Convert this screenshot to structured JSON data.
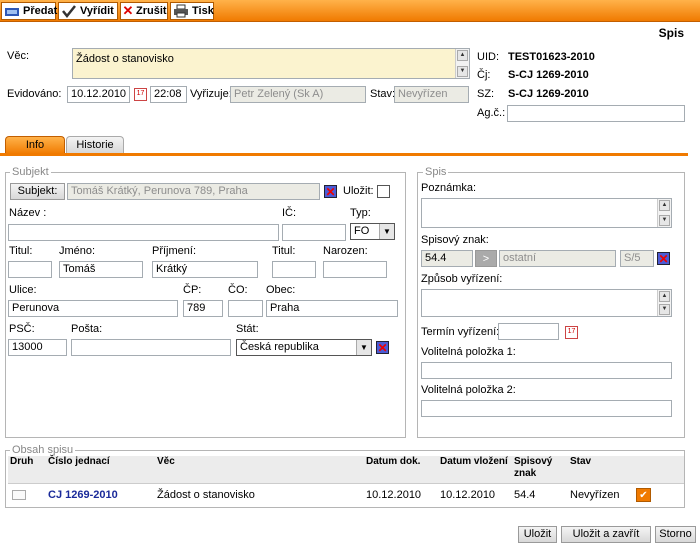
{
  "toolbar": {
    "predat": "Předat",
    "vyridit": "Vyřídit",
    "zrusit": "Zrušit",
    "tisk": "Tisk"
  },
  "page_title": "Spis",
  "header": {
    "vec_label": "Věc:",
    "vec_value": "Žádost o stanovisko",
    "uid_label": "UID:",
    "uid_value": "TEST01623-2010",
    "cj_label": "Čj:",
    "cj_value": "S-CJ 1269-2010",
    "sz_label": "SZ:",
    "sz_value": "S-CJ 1269-2010",
    "agc_label": "Ag.č.:",
    "agc_value": "",
    "evidovano_label": "Evidováno:",
    "evidovano_date": "10.12.2010",
    "evidovano_time": "22:08",
    "vyrizuje_label": "Vyřizuje:",
    "vyrizuje_value": "Petr Zelený (Sk A)",
    "stav_label": "Stav:",
    "stav_value": "Nevyřízen"
  },
  "tabs": {
    "info": "Info",
    "historie": "Historie"
  },
  "subjekt": {
    "legend": "Subjekt",
    "subjekt_button": "Subjekt:",
    "subjekt_value": "Tomáš Krátký, Perunova 789, Praha",
    "ulozit_label": "Uložit:",
    "nazev_label": "Název :",
    "nazev_value": "",
    "ic_label": "IČ:",
    "ic_value": "",
    "typ_label": "Typ:",
    "typ_value": "FO",
    "titul_label": "Titul:",
    "titul_value": "",
    "jmeno_label": "Jméno:",
    "jmeno_value": "Tomáš",
    "prijmeni_label": "Příjmení:",
    "prijmeni_value": "Krátký",
    "titul2_label": "Titul:",
    "titul2_value": "",
    "narozen_label": "Narozen:",
    "narozen_value": "",
    "ulice_label": "Ulice:",
    "ulice_value": "Perunova",
    "cp_label": "ČP:",
    "cp_value": "789",
    "co_label": "ČO:",
    "co_value": "",
    "obec_label": "Obec:",
    "obec_value": "Praha",
    "psc_label": "PSČ:",
    "psc_value": "13000",
    "posta_label": "Pošta:",
    "posta_value": "",
    "stat_label": "Stát:",
    "stat_value": "Česká republika"
  },
  "spis": {
    "legend": "Spis",
    "poznamka_label": "Poznámka:",
    "poznamka_value": "",
    "spisovy_znak_label": "Spisový znak:",
    "znak_value": "54.4",
    "znak_arrow": ">",
    "znak_text": "ostatní",
    "znak_skart": "S/5",
    "zpusob_label": "Způsob vyřízení:",
    "zpusob_value": "",
    "termin_label": "Termín vyřízení:",
    "termin_value": "",
    "volitelna1_label": "Volitelná položka 1:",
    "volitelna1_value": "",
    "volitelna2_label": "Volitelná položka 2:",
    "volitelna2_value": ""
  },
  "obsah": {
    "legend": "Obsah spisu",
    "columns": [
      "Druh",
      "Číslo jednací",
      "Věc",
      "Datum dok.",
      "Datum vložení",
      "Spisový znak",
      "Stav"
    ],
    "rows": [
      {
        "cislo": "CJ 1269-2010",
        "vec": "Žádost o stanovisko",
        "datum_dok": "10.12.2010",
        "datum_vlozeni": "10.12.2010",
        "spisovy_znak": "54.4",
        "stav": "Nevyřízen"
      }
    ]
  },
  "footer": {
    "ulozit": "Uložit",
    "ulozit_zavrit": "Uložit a zavřít",
    "storno": "Storno"
  },
  "colors": {
    "accent": "#f07a00",
    "link": "#1a2a9a"
  }
}
